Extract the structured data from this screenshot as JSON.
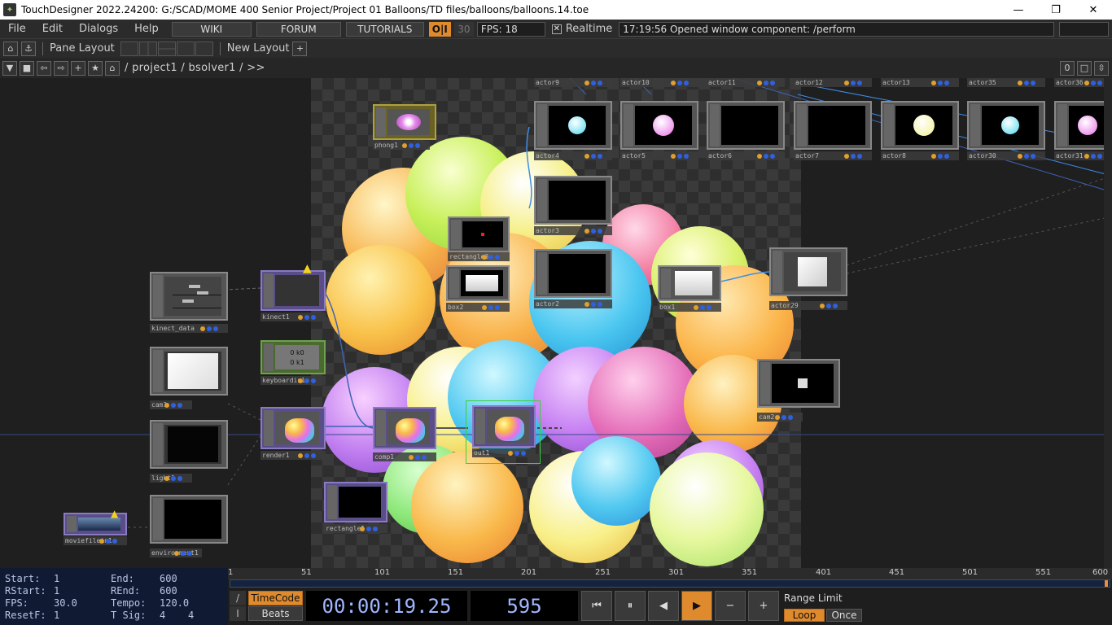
{
  "window": {
    "title": "TouchDesigner 2022.24200: G:/SCAD/MOME 400 Senior Project/Project 01 Balloons/TD files/balloons/balloons.14.toe",
    "minimize": "—",
    "maximize": "❐",
    "close": "✕"
  },
  "menu": {
    "items": [
      "File",
      "Edit",
      "Dialogs",
      "Help"
    ],
    "wiki": "WIKI",
    "forum": "FORUM",
    "tutorials": "TUTORIALS",
    "oi": "O|I",
    "cook": "30",
    "fps": "FPS:  18",
    "realtime": "Realtime",
    "status": "17:19:56 Opened window component: /perform"
  },
  "toolbar": {
    "pane_layout": "Pane Layout",
    "new_layout": "New Layout",
    "plus": "+"
  },
  "path": {
    "text": "/ project1 / bsolver1 / >>",
    "right_num": "0"
  },
  "nodes": [
    {
      "id": "phong1",
      "label": "phong1"
    },
    {
      "id": "actor9",
      "label": "actor9"
    },
    {
      "id": "actor10",
      "label": "actor10"
    },
    {
      "id": "actor11",
      "label": "actor11"
    },
    {
      "id": "actor12",
      "label": "actor12"
    },
    {
      "id": "actor13",
      "label": "actor13"
    },
    {
      "id": "actor35",
      "label": "actor35"
    },
    {
      "id": "actor36",
      "label": "actor36"
    },
    {
      "id": "actor4",
      "label": "actor4"
    },
    {
      "id": "actor5",
      "label": "actor5"
    },
    {
      "id": "actor6",
      "label": "actor6"
    },
    {
      "id": "actor7",
      "label": "actor7"
    },
    {
      "id": "actor8",
      "label": "actor8"
    },
    {
      "id": "actor30",
      "label": "actor30"
    },
    {
      "id": "actor31",
      "label": "actor31"
    },
    {
      "id": "actor3",
      "label": "actor3"
    },
    {
      "id": "rectangle3",
      "label": "rectangle3"
    },
    {
      "id": "box2",
      "label": "box2"
    },
    {
      "id": "actor2",
      "label": "actor2"
    },
    {
      "id": "box1",
      "label": "box1"
    },
    {
      "id": "actor29",
      "label": "actor29"
    },
    {
      "id": "kinect_data",
      "label": "kinect_data"
    },
    {
      "id": "kinect1",
      "label": "kinect1"
    },
    {
      "id": "keyboardin1",
      "label": "keyboardin1"
    },
    {
      "id": "cam1",
      "label": "cam1"
    },
    {
      "id": "render1",
      "label": "render1"
    },
    {
      "id": "comp1",
      "label": "comp1"
    },
    {
      "id": "out1",
      "label": "out1"
    },
    {
      "id": "cam2",
      "label": "cam2"
    },
    {
      "id": "light1",
      "label": "light1"
    },
    {
      "id": "rectangle1",
      "label": "rectangle1"
    },
    {
      "id": "moviefilein1",
      "label": "moviefilein1"
    },
    {
      "id": "environment1",
      "label": "environment1"
    }
  ],
  "keyboard_values": [
    "0 k0",
    "0 k1"
  ],
  "timeline": {
    "start_label": "Start:",
    "start": "1",
    "rstart_label": "RStart:",
    "rstart": "1",
    "fps_label": "FPS:",
    "fps": "30.0",
    "resetf_label": "ResetF:",
    "resetf": "1",
    "end_label": "End:",
    "end": "600",
    "rend_label": "REnd:",
    "rend": "600",
    "tempo_label": "Tempo:",
    "tempo": "120.0",
    "tsig_label": "T Sig:",
    "tsig_a": "4",
    "tsig_b": "4",
    "ruler": [
      "1",
      "51",
      "101",
      "151",
      "201",
      "251",
      "301",
      "351",
      "401",
      "451",
      "501",
      "551",
      "600"
    ],
    "timecode_btn": "TimeCode",
    "beats_btn": "Beats",
    "timecode": "00:00:19.25",
    "frame": "595",
    "range_limit": "Range Limit",
    "loop": "Loop",
    "once": "Once",
    "slash": "/",
    "bar": "I"
  },
  "colors": {
    "accent_orange": "#e08a2e",
    "selected_green": "#3bd13b",
    "timeline_blue": "#9fb6ff"
  }
}
